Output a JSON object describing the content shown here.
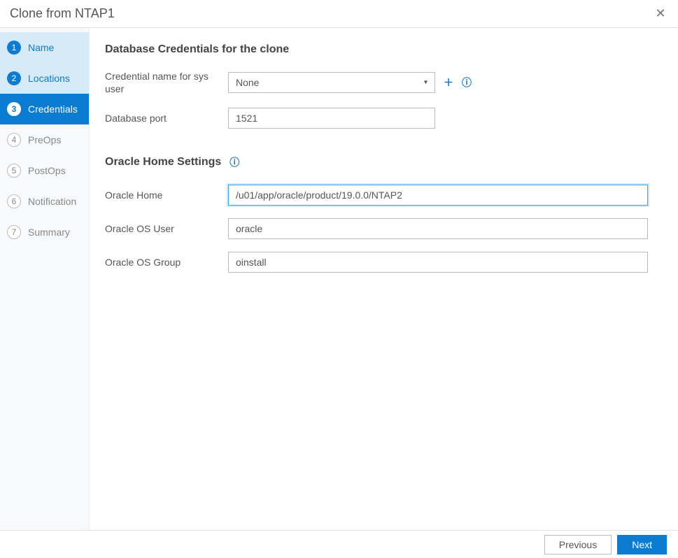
{
  "header": {
    "title": "Clone from NTAP1"
  },
  "sidebar": {
    "steps": [
      {
        "num": "1",
        "label": "Name",
        "state": "completed"
      },
      {
        "num": "2",
        "label": "Locations",
        "state": "completed"
      },
      {
        "num": "3",
        "label": "Credentials",
        "state": "active"
      },
      {
        "num": "4",
        "label": "PreOps",
        "state": "future"
      },
      {
        "num": "5",
        "label": "PostOps",
        "state": "future"
      },
      {
        "num": "6",
        "label": "Notification",
        "state": "future"
      },
      {
        "num": "7",
        "label": "Summary",
        "state": "future"
      }
    ]
  },
  "sections": {
    "s1": {
      "title": "Database Credentials for the clone",
      "credential_label": "Credential name for sys user",
      "credential_value": "None",
      "port_label": "Database port",
      "port_value": "1521"
    },
    "s2": {
      "title": "Oracle Home Settings",
      "home_label": "Oracle Home",
      "home_value": "/u01/app/oracle/product/19.0.0/NTAP2",
      "osuser_label": "Oracle OS User",
      "osuser_value": "oracle",
      "osgroup_label": "Oracle OS Group",
      "osgroup_value": "oinstall"
    }
  },
  "footer": {
    "previous": "Previous",
    "next": "Next"
  }
}
